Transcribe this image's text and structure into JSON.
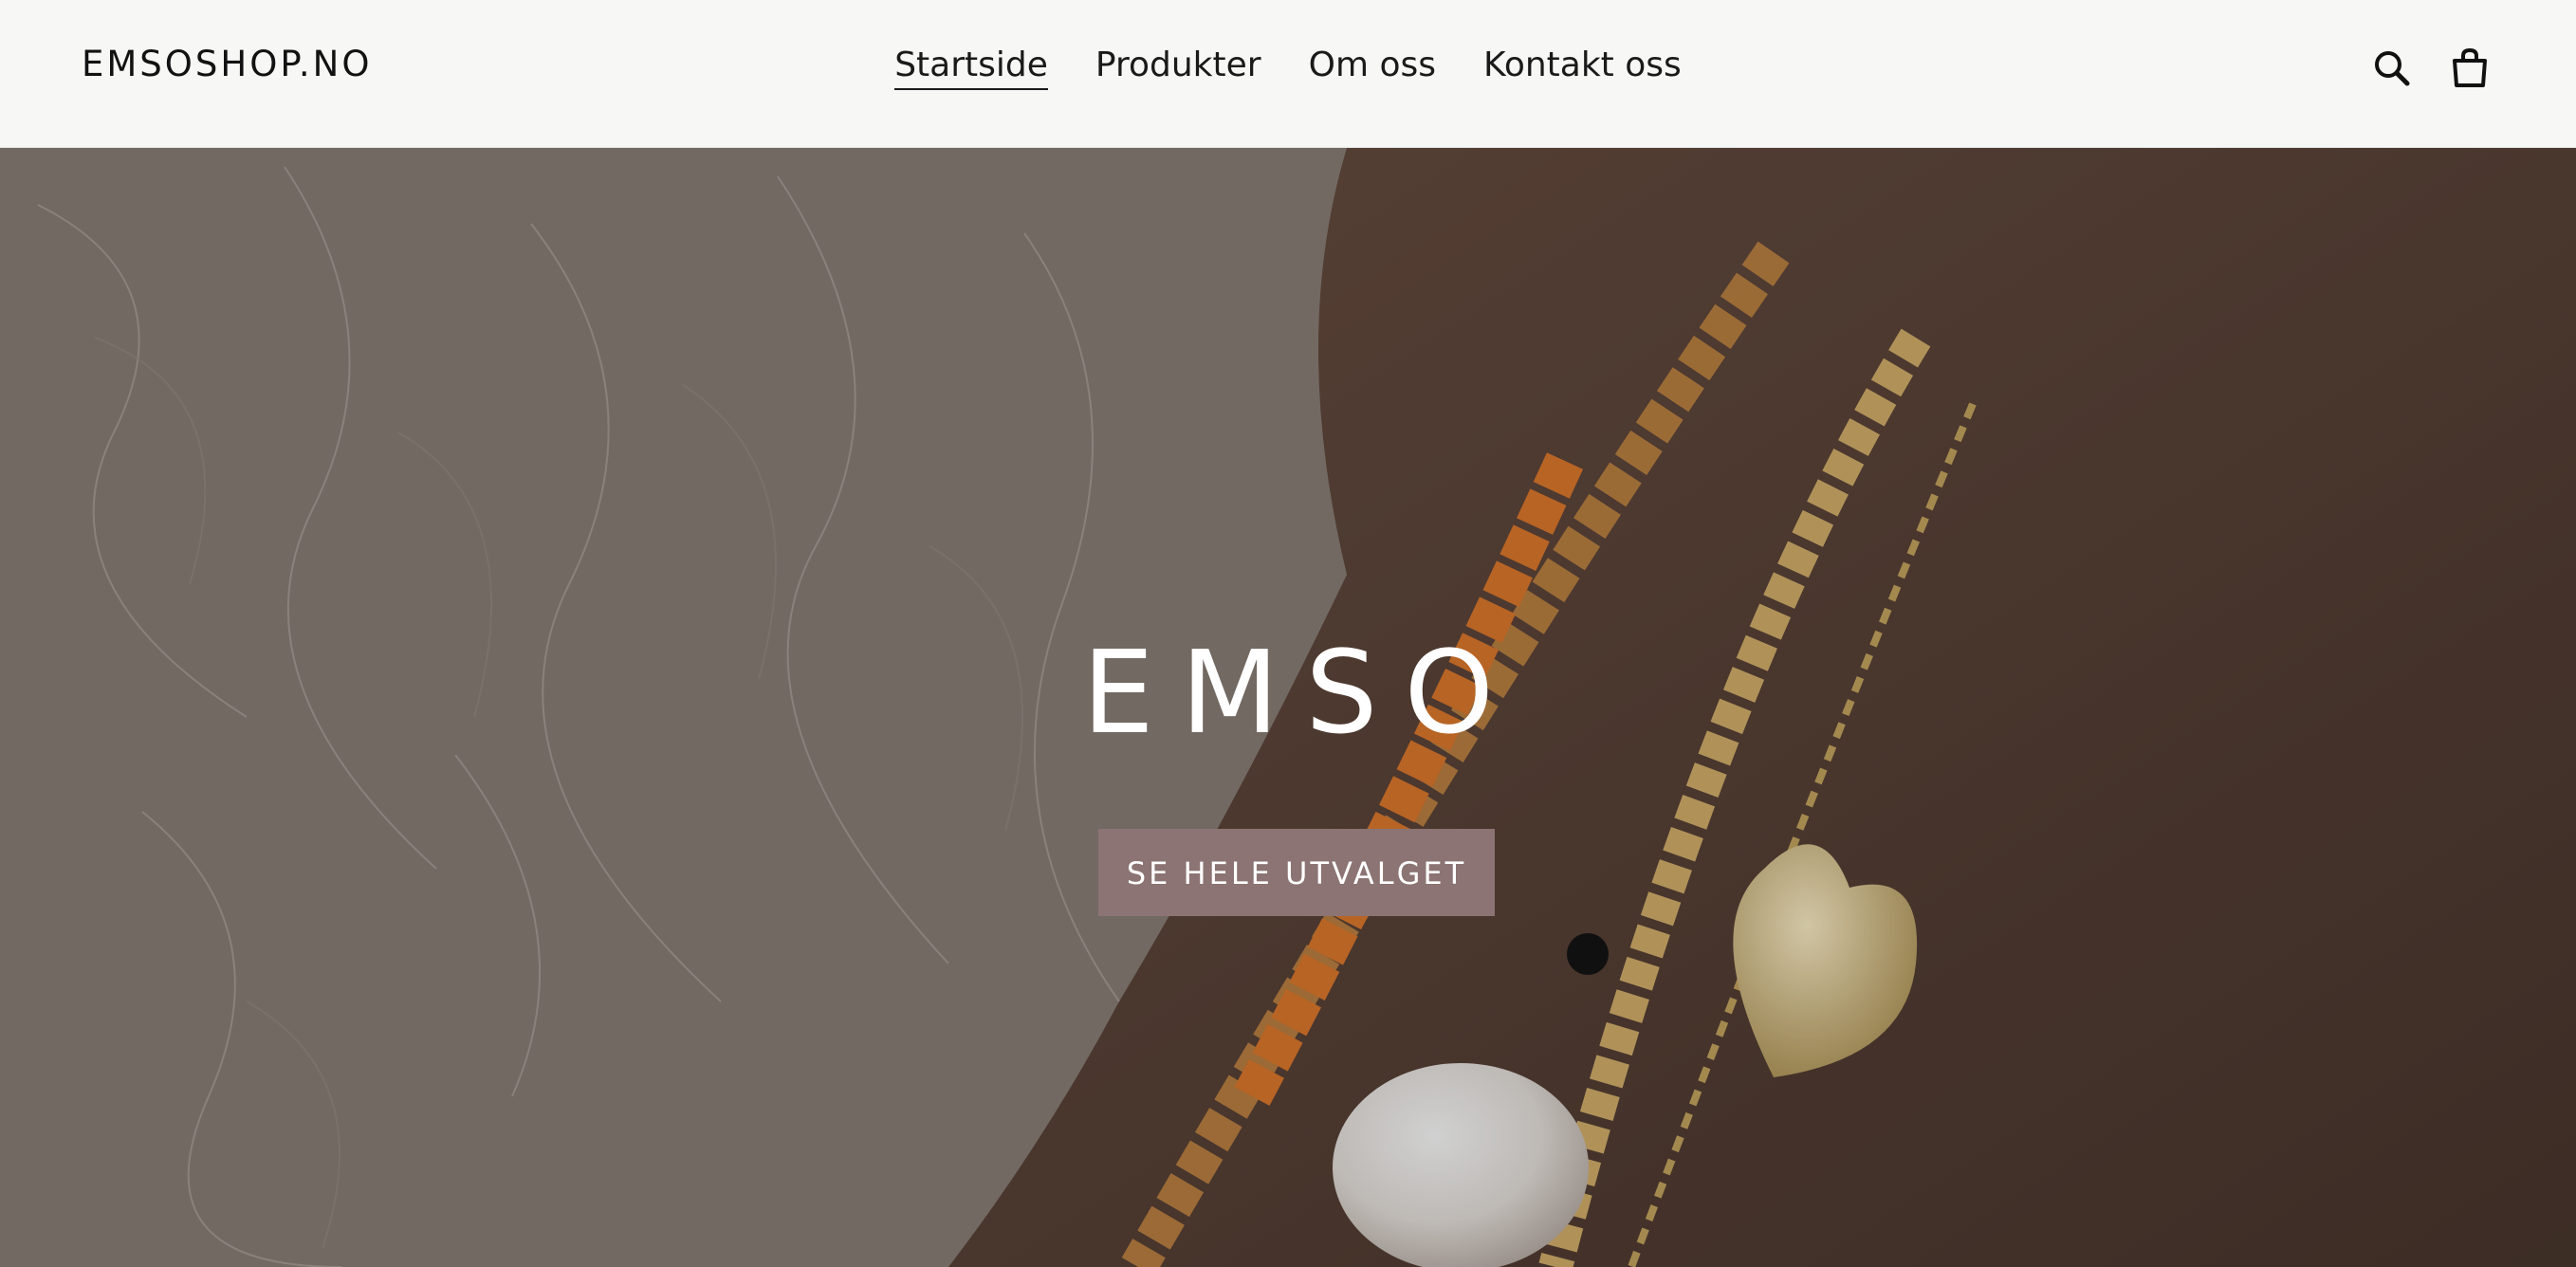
{
  "header": {
    "logo": "EMSOSHOP.NO",
    "nav": [
      {
        "label": "Startside",
        "active": true
      },
      {
        "label": "Produkter",
        "active": false
      },
      {
        "label": "Om oss",
        "active": false
      },
      {
        "label": "Kontakt oss",
        "active": false
      }
    ],
    "icons": [
      "search-icon",
      "cart-icon"
    ]
  },
  "hero": {
    "title": "EMSO",
    "cta_label": "SE HELE UTVALGET",
    "image": "hand-with-bracelets-photo"
  },
  "colors": {
    "header_bg": "#f7f7f6",
    "cta_bg": "#8b7473",
    "text": "#1f1f1f"
  }
}
